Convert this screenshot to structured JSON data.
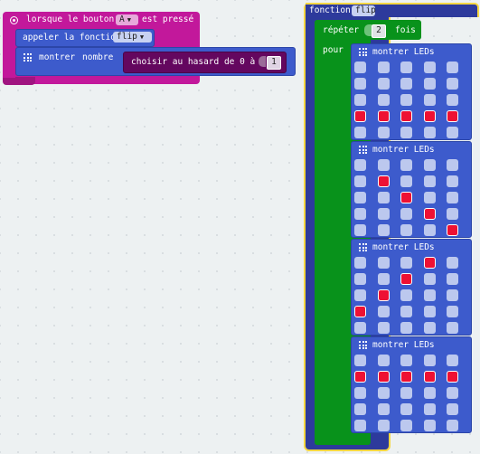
{
  "event_block": {
    "label_prefix": "lorsque le bouton",
    "button_value": "A",
    "label_suffix": "est pressé",
    "colors": {
      "block": "#c2189b",
      "dropdown": "#e6a9da"
    }
  },
  "call_block": {
    "label": "appeler la fonction",
    "function_value": "flip",
    "colors": {
      "block": "#3d5bcc"
    }
  },
  "show_number_block": {
    "label_show": "montrer",
    "label_number": "nombre",
    "icon": "grid-icon",
    "colors": {
      "block": "#3d5bcc"
    }
  },
  "random_block": {
    "label": "choisir au hasard de 0 à",
    "max_value": "1",
    "colors": {
      "block": "#64075f"
    }
  },
  "function_def": {
    "label": "fonction",
    "name": "flip",
    "colors": {
      "block": "#2d3a9c",
      "selected_outline": "#f5d742"
    }
  },
  "repeat_block": {
    "label_repeat": "répéter",
    "times_value": "2",
    "label_times": "fois",
    "label_do": "pour",
    "colors": {
      "block": "#08921b"
    }
  },
  "show_leds_blocks": [
    {
      "label": "montrer LEDs",
      "grid": [
        [
          0,
          0,
          0,
          0,
          0
        ],
        [
          0,
          0,
          0,
          0,
          0
        ],
        [
          0,
          0,
          0,
          0,
          0
        ],
        [
          1,
          1,
          1,
          1,
          1
        ],
        [
          0,
          0,
          0,
          0,
          0
        ]
      ]
    },
    {
      "label": "montrer LEDs",
      "grid": [
        [
          0,
          0,
          0,
          0,
          0
        ],
        [
          0,
          1,
          0,
          0,
          0
        ],
        [
          0,
          0,
          1,
          0,
          0
        ],
        [
          0,
          0,
          0,
          1,
          0
        ],
        [
          0,
          0,
          0,
          0,
          1
        ]
      ]
    },
    {
      "label": "montrer LEDs",
      "grid": [
        [
          0,
          0,
          0,
          1,
          0
        ],
        [
          0,
          0,
          1,
          0,
          0
        ],
        [
          0,
          1,
          0,
          0,
          0
        ],
        [
          1,
          0,
          0,
          0,
          0
        ],
        [
          0,
          0,
          0,
          0,
          0
        ]
      ]
    },
    {
      "label": "montrer LEDs",
      "grid": [
        [
          0,
          0,
          0,
          0,
          0
        ],
        [
          1,
          1,
          1,
          1,
          1
        ],
        [
          0,
          0,
          0,
          0,
          0
        ],
        [
          0,
          0,
          0,
          0,
          0
        ],
        [
          0,
          0,
          0,
          0,
          0
        ]
      ]
    }
  ],
  "led_colors": {
    "off": "#bcc8ee",
    "on": "#ee1133",
    "block": "#3d5bcc"
  }
}
